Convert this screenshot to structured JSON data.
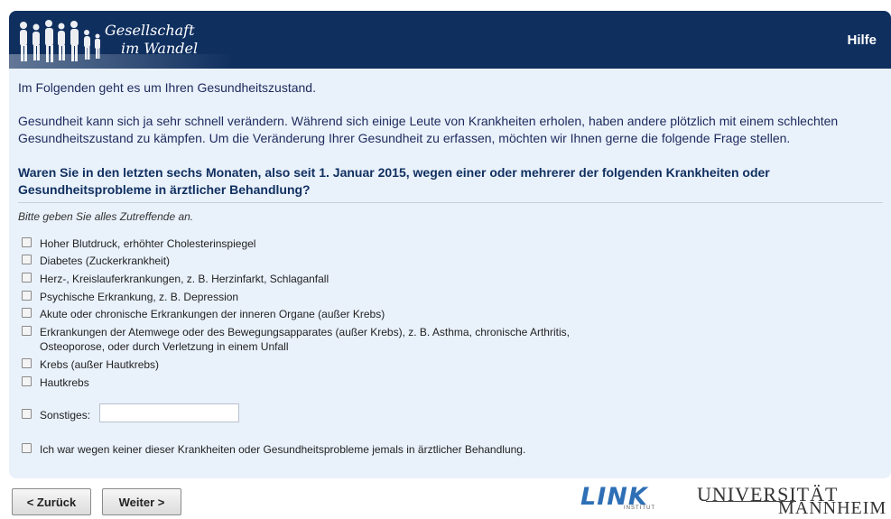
{
  "header": {
    "brand_line1": "Gesellschaft",
    "brand_line2": "im Wandel",
    "help_label": "Hilfe",
    "background_color": "#0f2f5f"
  },
  "content": {
    "intro1": "Im Folgenden geht es um Ihren Gesundheitszustand.",
    "intro2": "Gesundheit kann sich ja sehr schnell verändern. Während sich einige Leute von Krankheiten erholen, haben andere plötzlich mit einem schlechten Gesundheitszustand zu kämpfen. Um die Veränderung Ihrer Gesundheit zu erfassen, möchten wir Ihnen gerne die folgende Frage stellen.",
    "question": "Waren Sie in den letzten sechs Monaten, also seit 1. Januar 2015, wegen einer oder mehrerer der folgenden Krankheiten oder Gesundheitsprobleme in ärztlicher Behandlung?",
    "hint": "Bitte geben Sie alles Zutreffende an.",
    "options": [
      "Hoher Blutdruck, erhöhter Cholesterinspiegel",
      "Diabetes (Zuckerkrankheit)",
      "Herz-, Kreislauferkrankungen, z. B. Herzinfarkt, Schlaganfall",
      "Psychische Erkrankung, z. B. Depression",
      "Akute oder chronische Erkrankungen der inneren Organe (außer Krebs)",
      "Erkrankungen der Atemwege oder des Bewegungsapparates (außer Krebs), z. B. Asthma, chronische Arthritis,",
      "Osteoporose, oder durch Verletzung in einem Unfall",
      "Krebs (außer Hautkrebs)",
      "Hautkrebs"
    ],
    "other_label": "Sonstiges:",
    "other_value": "",
    "none_label": "Ich war wegen keiner dieser Krankheiten oder Gesundheitsprobleme jemals in ärztlicher Behandlung."
  },
  "nav": {
    "back_label": "< Zurück",
    "next_label": "Weiter >"
  },
  "logos": {
    "link_text": "LINK",
    "link_sub": "INSTITUT",
    "uni_line1": "UNIVERSITÄT",
    "uni_line2": "MANNHEIM"
  }
}
